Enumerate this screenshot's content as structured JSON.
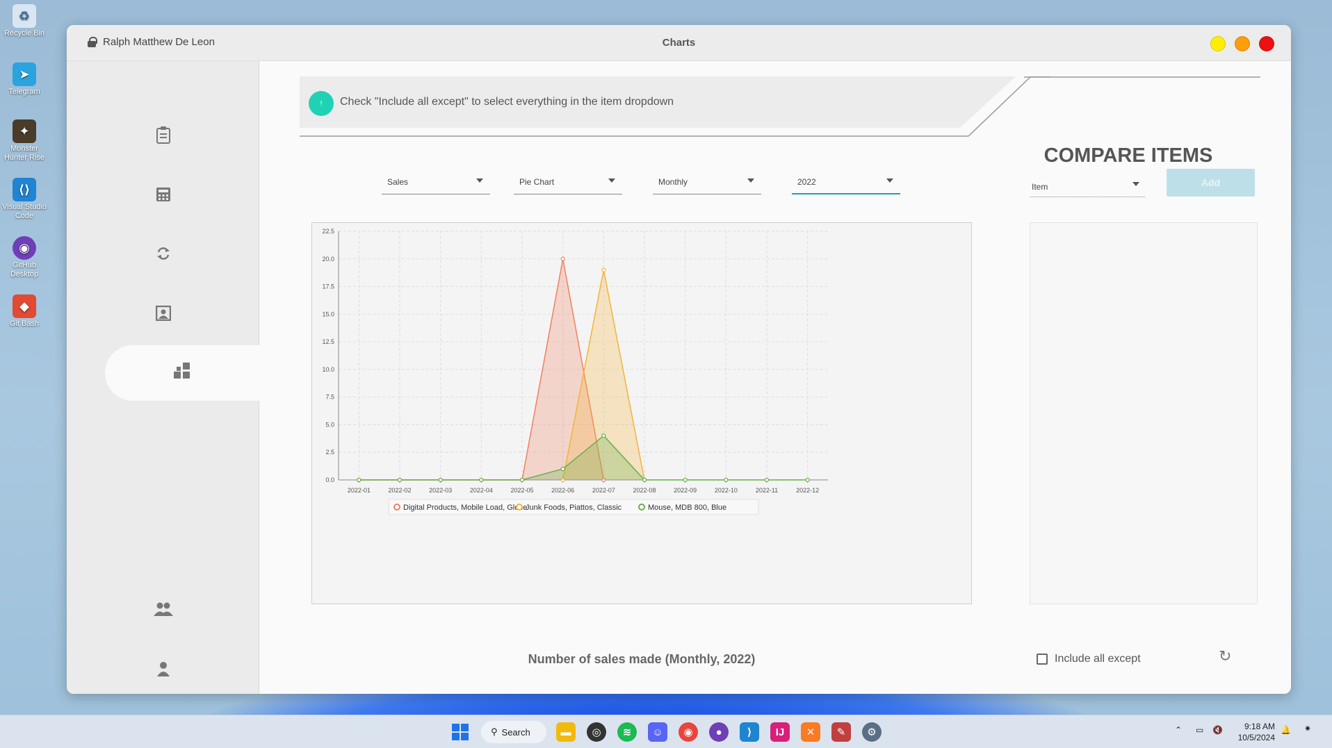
{
  "desktop": {
    "icons": [
      {
        "label": "Recycle Bin",
        "icon": "recycle-bin-icon"
      },
      {
        "label": "Telegram",
        "icon": "telegram-icon"
      },
      {
        "label": "Monster Hunter Rise",
        "icon": "game-icon"
      },
      {
        "label": "Visual Studio Code",
        "icon": "vscode-icon"
      },
      {
        "label": "GitHub Desktop",
        "icon": "github-icon"
      },
      {
        "label": "Git Bash",
        "icon": "git-icon"
      }
    ]
  },
  "window": {
    "user_name": "Ralph Matthew De Leon",
    "title": "Charts",
    "buttons": {
      "yellow": "#ffee00",
      "orange": "#ff9d0a",
      "red": "#ee1111"
    }
  },
  "sidebar": {
    "items": [
      {
        "icon": "clipboard-icon",
        "glyph": "📋"
      },
      {
        "icon": "calculator-icon",
        "glyph": "▦"
      },
      {
        "icon": "sync-icon",
        "glyph": "⟳"
      },
      {
        "icon": "portrait-icon",
        "glyph": "▣"
      },
      {
        "icon": "dashboard-icon",
        "glyph": "▞",
        "active": true
      },
      {
        "icon": "users-icon",
        "glyph": "👥"
      },
      {
        "icon": "user-icon",
        "glyph": "👤"
      }
    ]
  },
  "hint": {
    "badge": "!",
    "text": "Check \"Include all except\" to select everything in the item dropdown"
  },
  "filters": {
    "metric": "Sales",
    "chart_type": "Pie Chart",
    "period": "Monthly",
    "year": "2022"
  },
  "caption": "Number of sales made (Monthly, 2022)",
  "compare": {
    "title": "COMPARE ITEMS",
    "item_label": "Item",
    "add_label": "Add",
    "include_label": "Include all except"
  },
  "chart_data": {
    "type": "area",
    "x": [
      "2022-01",
      "2022-02",
      "2022-03",
      "2022-04",
      "2022-05",
      "2022-06",
      "2022-07",
      "2022-08",
      "2022-09",
      "2022-10",
      "2022-11",
      "2022-12"
    ],
    "ylim": [
      0,
      22.5
    ],
    "yticks": [
      "0.0",
      "2.5",
      "5.0",
      "7.5",
      "10.0",
      "12.5",
      "15.0",
      "17.5",
      "20.0",
      "22.5"
    ],
    "grid": true,
    "legend_position": "bottom",
    "series": [
      {
        "name": "Digital Products, Mobile Load, Globe",
        "color": "#f08060",
        "values": [
          0,
          0,
          0,
          0,
          0,
          20,
          0,
          null,
          null,
          null,
          null,
          null
        ]
      },
      {
        "name": "Junk Foods, Piattos, Classic",
        "color": "#f3b43a",
        "values": [
          null,
          null,
          null,
          null,
          null,
          0,
          19,
          0,
          null,
          null,
          null,
          null
        ]
      },
      {
        "name": "Mouse, MDB 800, Blue",
        "color": "#66b04a",
        "values": [
          0,
          0,
          0,
          0,
          0,
          1,
          4,
          0,
          0,
          0,
          0,
          0
        ]
      }
    ]
  },
  "taskbar": {
    "search_label": "Search",
    "apps": [
      {
        "icon": "windows-start-icon",
        "color": "#1e73e8"
      },
      {
        "icon": "file-explorer-icon",
        "color": "#f2b90d"
      },
      {
        "icon": "obs-icon",
        "color": "#333333"
      },
      {
        "icon": "spotify-icon",
        "color": "#1db954"
      },
      {
        "icon": "discord-icon",
        "color": "#5865f2"
      },
      {
        "icon": "chrome-icon",
        "color": "#e8453c"
      },
      {
        "icon": "github-icon",
        "color": "#6e3fb6"
      },
      {
        "icon": "vscode-icon",
        "color": "#1f84d1"
      },
      {
        "icon": "intellij-icon",
        "color": "#d7207a"
      },
      {
        "icon": "xampp-icon",
        "color": "#fb7a24"
      },
      {
        "icon": "java-app-icon",
        "color": "#c04040"
      },
      {
        "icon": "settings-icon",
        "color": "#5a6f86"
      }
    ],
    "time": "9:18 AM",
    "date": "10/5/2024"
  }
}
